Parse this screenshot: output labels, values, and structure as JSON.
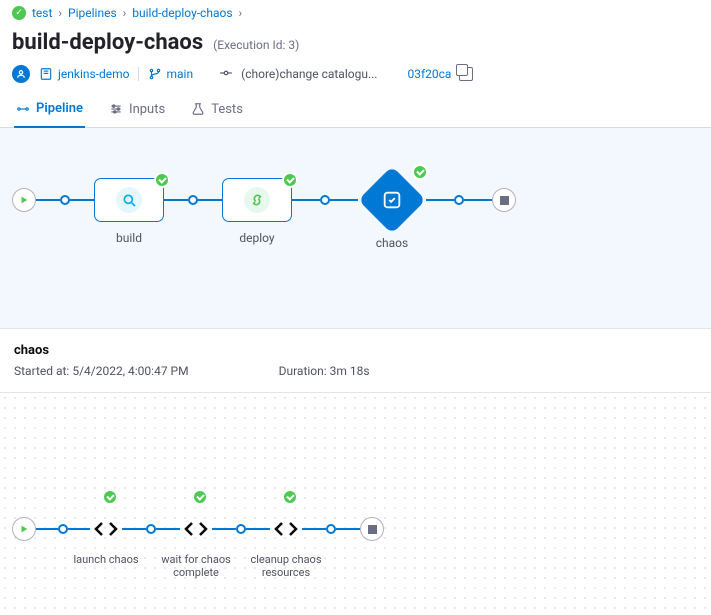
{
  "breadcrumb": {
    "items": [
      "test",
      "Pipelines",
      "build-deploy-chaos"
    ]
  },
  "heading": {
    "title": "build-deploy-chaos",
    "subtitle": "(Execution Id: 3)"
  },
  "meta": {
    "repo": "jenkins-demo",
    "branch": "main",
    "commit_msg": "(chore)change catalogu...",
    "commit_sha": "03f20ca"
  },
  "tabs": {
    "pipeline": "Pipeline",
    "inputs": "Inputs",
    "tests": "Tests"
  },
  "pipeline": {
    "stages": [
      {
        "label": "build",
        "icon": "search",
        "color": "#00ADE4"
      },
      {
        "label": "deploy",
        "icon": "link",
        "color": "#4DC952"
      },
      {
        "label": "chaos",
        "icon": "diamond",
        "selected": true
      }
    ]
  },
  "details": {
    "name": "chaos",
    "started_label": "Started at:",
    "started_value": "5/4/2022, 4:00:47 PM",
    "duration_label": "Duration:",
    "duration_value": "3m 18s"
  },
  "steps": [
    {
      "label": "launch chaos"
    },
    {
      "label": "wait for chaos complete"
    },
    {
      "label": "cleanup chaos resources"
    }
  ]
}
